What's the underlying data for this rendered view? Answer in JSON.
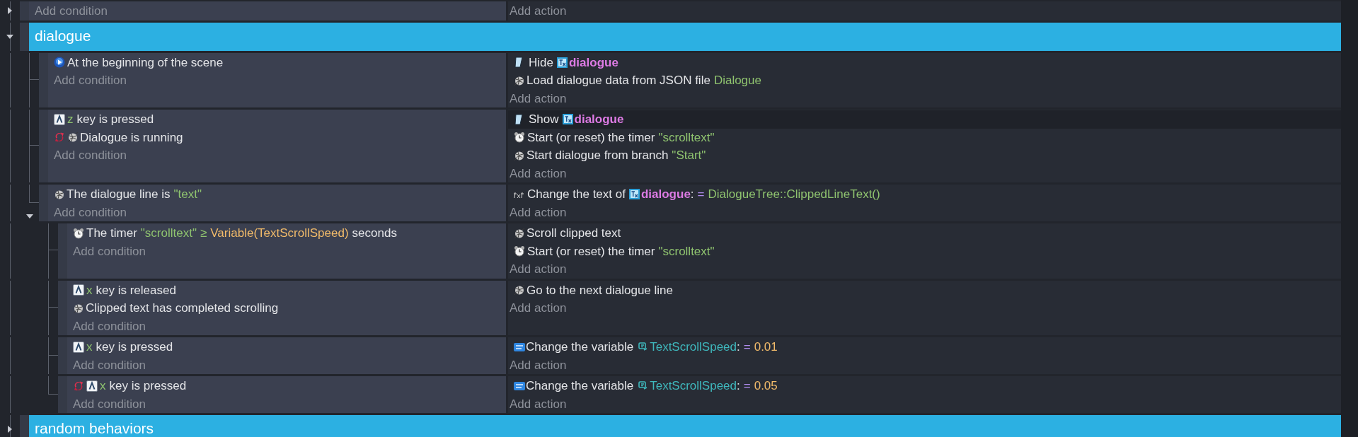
{
  "events": [
    {
      "kind": "event",
      "expanded": false,
      "add_condition": "Add condition",
      "add_action": "Add action"
    },
    {
      "kind": "group",
      "title": "dialogue",
      "expanded": true,
      "children": [
        {
          "kind": "event",
          "add_condition": "Add condition",
          "add_action": "Add action",
          "conditions": [
            {
              "kind": "scene",
              "parts": [
                {
                  "kind": "plain",
                  "text": "At the beginning of the scene"
                }
              ]
            }
          ],
          "actions": [
            {
              "kind": "visibility",
              "parts": [
                {
                  "kind": "plain",
                  "text": "Hide"
                },
                {
                  "kind": "object",
                  "text": "dialogue"
                }
              ]
            },
            {
              "kind": "dialogue",
              "parts": [
                {
                  "kind": "plain",
                  "text": "Load dialogue data from JSON file"
                },
                {
                  "kind": "param",
                  "text": "Dialogue"
                }
              ]
            }
          ]
        },
        {
          "kind": "event",
          "add_condition": "Add condition",
          "add_action": "Add action",
          "conditions": [
            {
              "kind": "keyboard",
              "parts": [
                {
                  "kind": "param",
                  "text": "z"
                },
                {
                  "kind": "plain",
                  "text": "key is pressed"
                }
              ]
            },
            {
              "kind": "dialogue",
              "inverted": true,
              "parts": [
                {
                  "kind": "plain",
                  "text": "Dialogue is running"
                }
              ]
            }
          ],
          "actions": [
            {
              "kind": "visibility",
              "highlighted": true,
              "parts": [
                {
                  "kind": "plain",
                  "text": "Show"
                },
                {
                  "kind": "object",
                  "text": "dialogue"
                }
              ]
            },
            {
              "kind": "timer",
              "parts": [
                {
                  "kind": "plain",
                  "text": "Start (or reset) the timer"
                },
                {
                  "kind": "param",
                  "text": "\"scrolltext\""
                }
              ]
            },
            {
              "kind": "dialogue",
              "parts": [
                {
                  "kind": "plain",
                  "text": "Start dialogue from branch"
                },
                {
                  "kind": "param",
                  "text": "\"Start\""
                }
              ]
            }
          ]
        },
        {
          "kind": "event",
          "expanded": true,
          "add_condition": "Add condition",
          "add_action": "Add action",
          "conditions": [
            {
              "kind": "dialogue",
              "parts": [
                {
                  "kind": "plain",
                  "text": "The dialogue line is"
                },
                {
                  "kind": "param",
                  "text": "\"text\""
                }
              ]
            }
          ],
          "actions": [
            {
              "kind": "text",
              "parts": [
                {
                  "kind": "plain",
                  "text": "Change the text of"
                },
                {
                  "kind": "object",
                  "text": "dialogue"
                },
                {
                  "kind": "colon",
                  "text": ":"
                },
                {
                  "kind": "operator",
                  "text": "="
                },
                {
                  "kind": "param",
                  "text": "DialogueTree::ClippedLineText()"
                }
              ]
            }
          ],
          "children": [
            {
              "kind": "event",
              "add_condition": "Add condition",
              "add_action": "Add action",
              "conditions": [
                {
                  "kind": "timer",
                  "parts": [
                    {
                      "kind": "plain",
                      "text": "The timer"
                    },
                    {
                      "kind": "param",
                      "text": "\"scrolltext\""
                    },
                    {
                      "kind": "param",
                      "text": "≥"
                    },
                    {
                      "kind": "number",
                      "text": "Variable(TextScrollSpeed)"
                    },
                    {
                      "kind": "plain",
                      "text": "seconds"
                    }
                  ]
                }
              ],
              "actions": [
                {
                  "kind": "dialogue",
                  "parts": [
                    {
                      "kind": "plain",
                      "text": "Scroll clipped text"
                    }
                  ]
                },
                {
                  "kind": "timer",
                  "parts": [
                    {
                      "kind": "plain",
                      "text": "Start (or reset) the timer"
                    },
                    {
                      "kind": "param",
                      "text": "\"scrolltext\""
                    }
                  ]
                }
              ]
            },
            {
              "kind": "event",
              "add_condition": "Add condition",
              "add_action": "Add action",
              "conditions": [
                {
                  "kind": "keyboard",
                  "parts": [
                    {
                      "kind": "param",
                      "text": "x"
                    },
                    {
                      "kind": "plain",
                      "text": "key is released"
                    }
                  ]
                },
                {
                  "kind": "dialogue",
                  "parts": [
                    {
                      "kind": "plain",
                      "text": "Clipped text has completed scrolling"
                    }
                  ]
                }
              ],
              "actions": [
                {
                  "kind": "dialogue",
                  "parts": [
                    {
                      "kind": "plain",
                      "text": "Go to the next dialogue line"
                    }
                  ]
                }
              ]
            },
            {
              "kind": "event",
              "add_condition": "Add condition",
              "add_action": "Add action",
              "conditions": [
                {
                  "kind": "keyboard",
                  "parts": [
                    {
                      "kind": "param",
                      "text": "x"
                    },
                    {
                      "kind": "plain",
                      "text": "key is pressed"
                    }
                  ]
                }
              ],
              "actions": [
                {
                  "kind": "variable",
                  "parts": [
                    {
                      "kind": "plain",
                      "text": "Change the variable"
                    },
                    {
                      "kind": "variable",
                      "text": "TextScrollSpeed"
                    },
                    {
                      "kind": "colon",
                      "text": ":"
                    },
                    {
                      "kind": "operator",
                      "text": "="
                    },
                    {
                      "kind": "number",
                      "text": "0.01"
                    }
                  ]
                }
              ]
            },
            {
              "kind": "event",
              "add_condition": "Add condition",
              "add_action": "Add action",
              "conditions": [
                {
                  "kind": "keyboard",
                  "inverted": true,
                  "parts": [
                    {
                      "kind": "param",
                      "text": "x"
                    },
                    {
                      "kind": "plain",
                      "text": "key is pressed"
                    }
                  ]
                }
              ],
              "actions": [
                {
                  "kind": "variable",
                  "parts": [
                    {
                      "kind": "plain",
                      "text": "Change the variable"
                    },
                    {
                      "kind": "variable",
                      "text": "TextScrollSpeed"
                    },
                    {
                      "kind": "colon",
                      "text": ":"
                    },
                    {
                      "kind": "operator",
                      "text": "="
                    },
                    {
                      "kind": "number",
                      "text": "0.05"
                    }
                  ]
                }
              ]
            }
          ]
        }
      ]
    },
    {
      "kind": "group",
      "title": "random behaviors",
      "expanded": false
    }
  ]
}
